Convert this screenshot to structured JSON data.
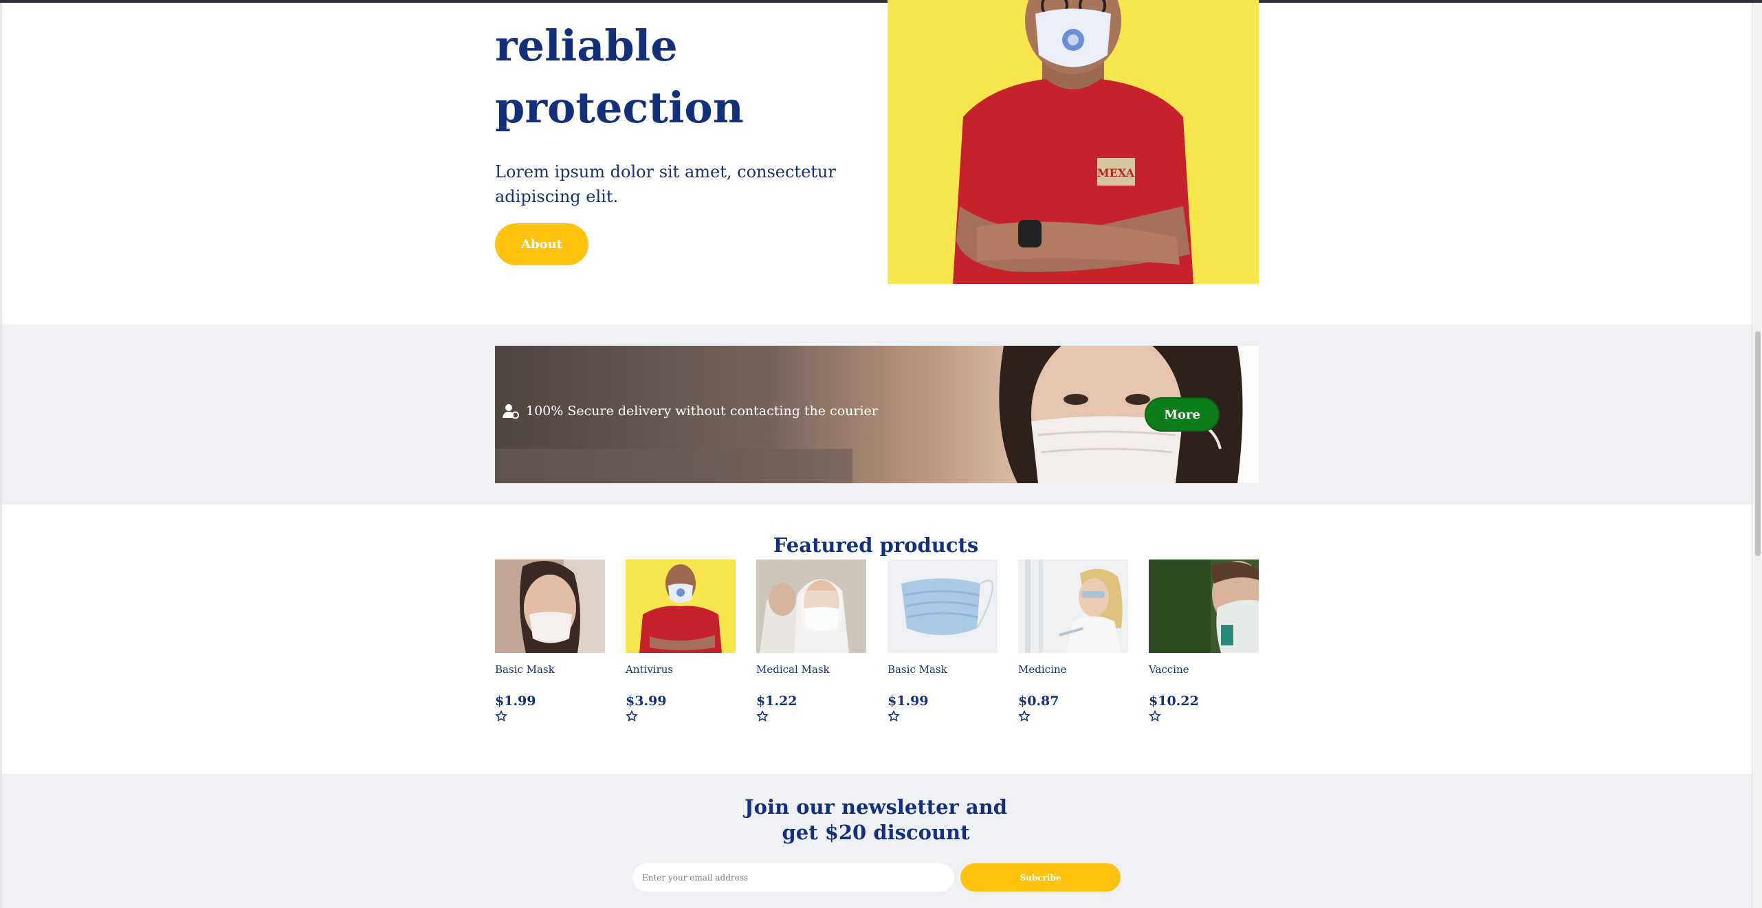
{
  "hero": {
    "title_line1": "reliable",
    "title_line2": "protection",
    "description": "Lorem ipsum dolor sit amet, consectetur adipiscing elit.",
    "about_button": "About"
  },
  "banner": {
    "text": "100% Secure delivery without contacting the courier",
    "more_button": "More"
  },
  "featured": {
    "title": "Featured products",
    "products": [
      {
        "name": "Basic Mask",
        "price": "$1.99"
      },
      {
        "name": "Antivirus",
        "price": "$3.99"
      },
      {
        "name": "Medical Mask",
        "price": "$1.22"
      },
      {
        "name": "Basic Mask",
        "price": "$1.99"
      },
      {
        "name": "Medicine",
        "price": "$0.87"
      },
      {
        "name": "Vaccine",
        "price": "$10.22"
      }
    ]
  },
  "newsletter": {
    "title_line1": "Join our newsletter and",
    "title_line2": "get $20 discount",
    "email_placeholder": "Enter your email address",
    "subscribe_button": "Subcribe"
  },
  "colors": {
    "primary_text": "#14307a",
    "accent_yellow": "#ffc20e",
    "button_green": "#0c7d1a",
    "section_gray": "#eff0f4"
  }
}
